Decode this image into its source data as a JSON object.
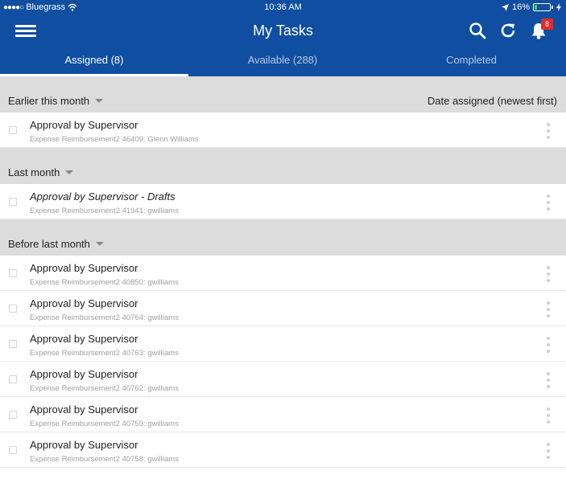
{
  "status_bar": {
    "carrier": "Bluegrass",
    "time": "10:36 AM",
    "battery_percent": "16%",
    "battery_level": 0.16,
    "icons": [
      "signal-dots-icon",
      "wifi-icon",
      "location-arrow-icon",
      "battery-icon",
      "charging-icon"
    ]
  },
  "header": {
    "title": "My Tasks",
    "notification_count": "8",
    "icons": [
      "menu-icon",
      "search-icon",
      "refresh-icon",
      "bell-icon"
    ],
    "colors": {
      "bar": "#0f4ea0",
      "badge": "#e02b2b"
    }
  },
  "tabs": [
    {
      "label": "Assigned (8)",
      "active": true
    },
    {
      "label": "Available (288)",
      "active": false
    },
    {
      "label": "Completed",
      "active": false
    }
  ],
  "sort_label": "Date assigned (newest first)",
  "groups": [
    {
      "label": "Earlier this month",
      "tasks": [
        {
          "title": "Approval by Supervisor",
          "subtitle": "Expense Reimbursement2 46409: Glenn Williams",
          "italic": false
        }
      ]
    },
    {
      "label": "Last month",
      "tasks": [
        {
          "title": "Approval by Supervisor - Drafts",
          "subtitle": "Expense Reimbursement2 41941: gwilliams",
          "italic": true
        }
      ]
    },
    {
      "label": "Before last month",
      "tasks": [
        {
          "title": "Approval by Supervisor",
          "subtitle": "Expense Reimbursement2 40850: gwilliams",
          "italic": false
        },
        {
          "title": "Approval by Supervisor",
          "subtitle": "Expense Reimbursement2 40764: gwilliams",
          "italic": false
        },
        {
          "title": "Approval by Supervisor",
          "subtitle": "Expense Reimbursement2 40763: gwilliams",
          "italic": false
        },
        {
          "title": "Approval by Supervisor",
          "subtitle": "Expense Reimbursement2 40762: gwilliams",
          "italic": false
        },
        {
          "title": "Approval by Supervisor",
          "subtitle": "Expense Reimbursement2 40759: gwilliams",
          "italic": false
        },
        {
          "title": "Approval by Supervisor",
          "subtitle": "Expense Reimbursement2 40758: gwilliams",
          "italic": false
        }
      ]
    }
  ]
}
